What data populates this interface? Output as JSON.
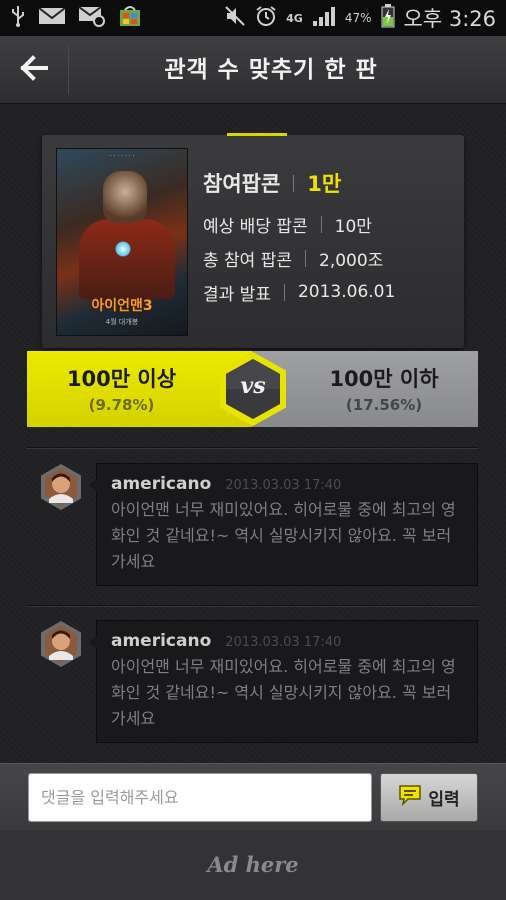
{
  "status_bar": {
    "network": "4G",
    "battery": "47%",
    "time": "오후 3:26",
    "icons": [
      "usb-icon",
      "mail-icon",
      "email-icon",
      "store-icon",
      "mute-icon",
      "alarm-icon",
      "signal-icon",
      "battery-icon"
    ]
  },
  "header": {
    "title": "관객 수 맞추기 한 판",
    "back_icon": "back-arrow-icon"
  },
  "movie": {
    "poster_title": "아이언맨3",
    "poster_date": "4월 대개봉",
    "category": "참여팝콘",
    "category_value": "1만",
    "rows": [
      {
        "label": "예상 배당 팝콘",
        "value": "10만"
      },
      {
        "label": "총 참여 팝콘",
        "value": "2,000조"
      },
      {
        "label": "결과 발표",
        "value": "2013.06.01"
      }
    ]
  },
  "vs": {
    "left_label": "100만 이상",
    "left_pct": "(9.78%)",
    "right_label": "100만 이하",
    "right_pct": "(17.56%)",
    "vs_text": "vs",
    "colors": {
      "left": "#e6e400",
      "right": "#94959a"
    }
  },
  "comments": [
    {
      "user": "americano",
      "date": "2013.03.03 17:40",
      "text": "아이언맨 너무 재미있어요. 히어로물 중에 최고의 영화인 것 같네요!~ 역시 실망시키지 않아요. 꼭 보러 가세요"
    },
    {
      "user": "americano",
      "date": "2013.03.03 17:40",
      "text": "아이언맨 너무 재미있어요. 히어로물 중에 최고의 영화인 것 같네요!~ 역시 실망시키지 않아요. 꼭 보러 가세요"
    }
  ],
  "comment_input": {
    "placeholder": "댓글을 입력해주세요",
    "value": "",
    "submit_label": "입력"
  },
  "ad": {
    "text": "Ad here"
  }
}
